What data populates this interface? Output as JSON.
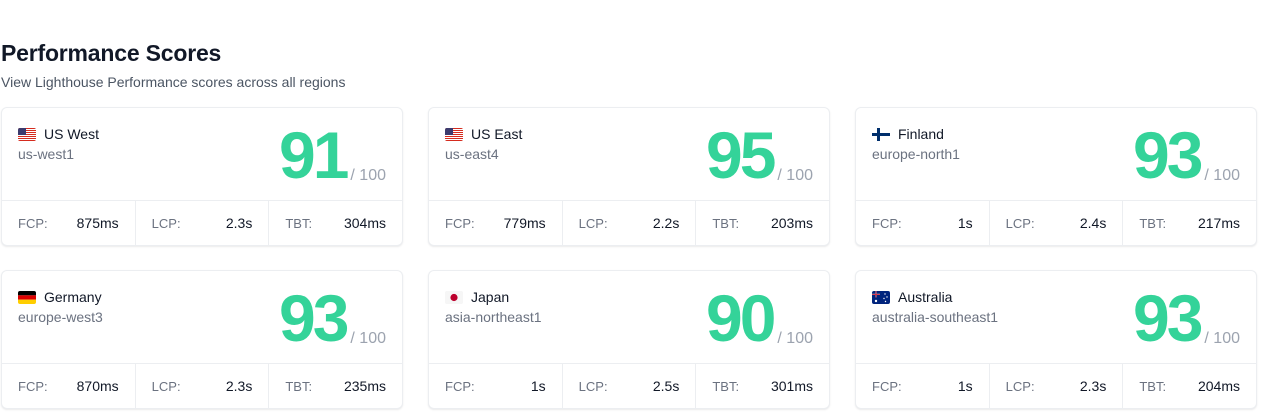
{
  "header": {
    "title": "Performance Scores",
    "subtitle": "View Lighthouse Performance scores across all regions"
  },
  "score_max_label": "/ 100",
  "metric_labels": {
    "fcp": "FCP:",
    "lcp": "LCP:",
    "tbt": "TBT:"
  },
  "regions": [
    {
      "name": "US West",
      "code": "us-west1",
      "flag": "us-flag-icon",
      "score": "91",
      "fcp": "875ms",
      "lcp": "2.3s",
      "tbt": "304ms"
    },
    {
      "name": "US East",
      "code": "us-east4",
      "flag": "us-flag-icon",
      "score": "95",
      "fcp": "779ms",
      "lcp": "2.2s",
      "tbt": "203ms"
    },
    {
      "name": "Finland",
      "code": "europe-north1",
      "flag": "finland-flag-icon",
      "score": "93",
      "fcp": "1s",
      "lcp": "2.4s",
      "tbt": "217ms"
    },
    {
      "name": "Germany",
      "code": "europe-west3",
      "flag": "germany-flag-icon",
      "score": "93",
      "fcp": "870ms",
      "lcp": "2.3s",
      "tbt": "235ms"
    },
    {
      "name": "Japan",
      "code": "asia-northeast1",
      "flag": "japan-flag-icon",
      "score": "90",
      "fcp": "1s",
      "lcp": "2.5s",
      "tbt": "301ms"
    },
    {
      "name": "Australia",
      "code": "australia-southeast1",
      "flag": "australia-flag-icon",
      "score": "93",
      "fcp": "1s",
      "lcp": "2.3s",
      "tbt": "204ms"
    }
  ],
  "colors": {
    "score": "#34d399",
    "title": "#111827",
    "muted": "#6b7280"
  }
}
